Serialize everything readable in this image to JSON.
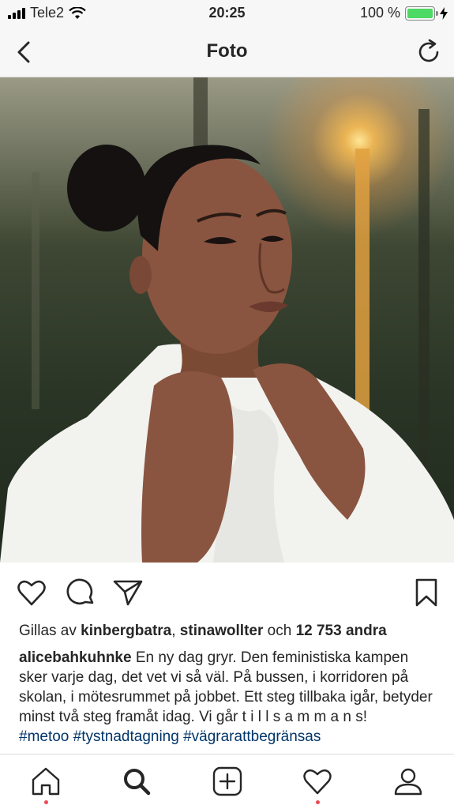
{
  "status_bar": {
    "carrier": "Tele2",
    "time": "20:25",
    "battery_percent": "100 %",
    "battery_level": 1.0
  },
  "nav": {
    "title": "Foto",
    "back_icon": "chevron-left-icon",
    "refresh_icon": "refresh-icon"
  },
  "post": {
    "photo_icon": "post-photo",
    "likes": {
      "prefix": "Gillas av ",
      "user1": "kinbergbatra",
      "sep": ", ",
      "user2": "stinawollter",
      "mid": " och ",
      "others": "12 753 andra"
    },
    "caption": {
      "username": "alicebahkuhnke",
      "text": " En ny dag gryr. Den feministiska kampen sker varje dag, det vet vi så väl. På bussen, i korridoren på skolan, i mötesrummet på jobbet. Ett steg tillbaka igår, betyder minst två steg framåt idag. Vi går t i l l s a m m a n s!",
      "hashtags": "#metoo #tystnadtagning #vägrarattbegränsas"
    }
  },
  "colors": {
    "bar_bg": "#f7f7f7",
    "notification_dot": "#ed4956",
    "battery_green": "#4cd964",
    "hashtag": "#003569"
  }
}
